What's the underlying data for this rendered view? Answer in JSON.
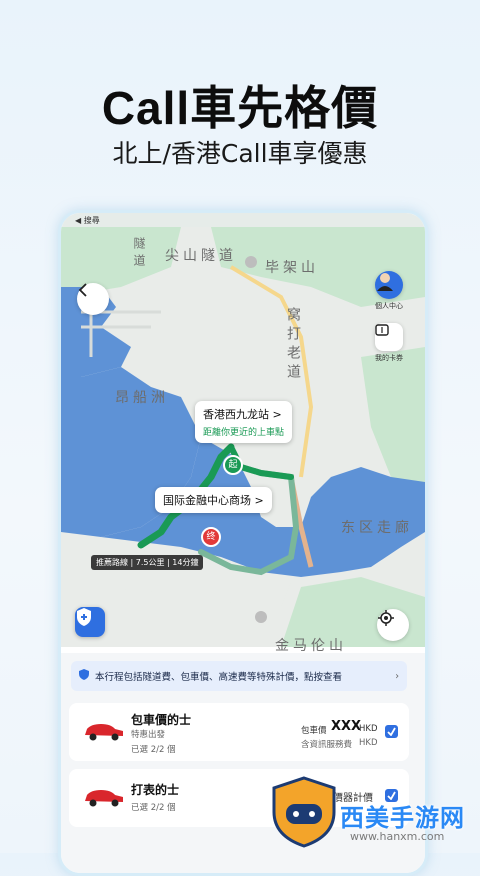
{
  "hero": {
    "title": "Call車先格價",
    "subtitle": "北上/香港Call車享優惠"
  },
  "status_bar": {
    "search_label": "◀ 搜尋"
  },
  "map": {
    "labels": {
      "lion_rock_tunnel": "尖山隧道",
      "tunnel_top": "隧道",
      "pat_heung": "毕架山",
      "waterloo": "窝打老道",
      "stonecutters": "昂船洲",
      "eastern_corridor": "东区走廊",
      "kam_ma": "金马伦山"
    },
    "pickup_callout": {
      "title": "香港西九龙站 >",
      "subtitle": "距離你更近的上車點"
    },
    "dropoff_callout": {
      "title": "国际金融中心商场 >"
    },
    "route_badge": "推薦路線 | 7.5公里 | 14分鐘",
    "start_pin": "起",
    "end_pin": "终",
    "avatar_label": "個人中心",
    "wallet_label": "我的卡券"
  },
  "panel": {
    "notice": "本行程包括隧道費、包車價、高速費等特殊計價，點按查看",
    "options": [
      {
        "title": "包車價的士",
        "sub": "特惠出發",
        "selected_text": "已選 2/2 個",
        "price_label": "包車價",
        "price": "XXX",
        "currency": "HKD",
        "fee_label": "含資訊服務費",
        "fee_currency": "HKD",
        "checked": true
      },
      {
        "title": "打表的士",
        "selected_text": "已選 2/2 個",
        "price_label": "計價器計價",
        "checked": true
      }
    ]
  },
  "watermark": {
    "text": "西美手游网",
    "url": "www.hanxm.com"
  },
  "colors": {
    "route": "#1a9a55",
    "accent": "#2f6fe0",
    "water": "#5e92d6",
    "land": "#e9ece9",
    "green_area": "#c9e6cf"
  }
}
